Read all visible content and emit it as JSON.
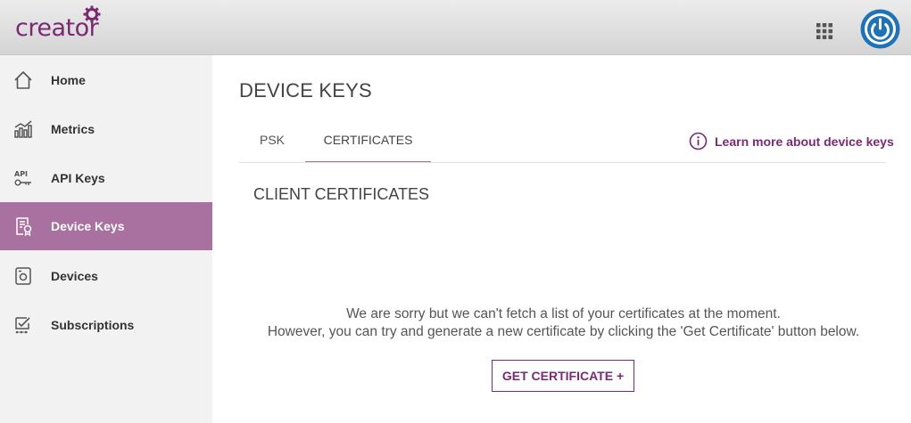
{
  "brand": {
    "logo_text": "creator"
  },
  "header": {
    "apps_icon": "apps-grid-icon",
    "power_icon": "power-icon",
    "accent_color": "#1e73b8"
  },
  "sidebar": {
    "active_color": "#a8719f",
    "items": [
      {
        "label": "Home",
        "icon": "home-icon",
        "active": false
      },
      {
        "label": "Metrics",
        "icon": "chart-icon",
        "active": false
      },
      {
        "label": "API Keys",
        "icon": "api-key-icon",
        "active": false
      },
      {
        "label": "Device Keys",
        "icon": "certificate-icon",
        "active": true
      },
      {
        "label": "Devices",
        "icon": "device-icon",
        "active": false
      },
      {
        "label": "Subscriptions",
        "icon": "subscriptions-icon",
        "active": false
      }
    ]
  },
  "main": {
    "title": "DEVICE KEYS",
    "tabs": [
      {
        "label": "PSK",
        "active": false
      },
      {
        "label": "CERTIFICATES",
        "active": true
      }
    ],
    "learn_more": "Learn more about device keys",
    "section_title": "CLIENT CERTIFICATES",
    "message_line1": "We are sorry but we can't fetch a list of your certificates at the moment.",
    "message_line2": "However, you can try and generate a new certificate by clicking the 'Get Certificate' button below.",
    "get_certificate_label": "GET CERTIFICATE +"
  },
  "brand_color": "#7a2a73"
}
